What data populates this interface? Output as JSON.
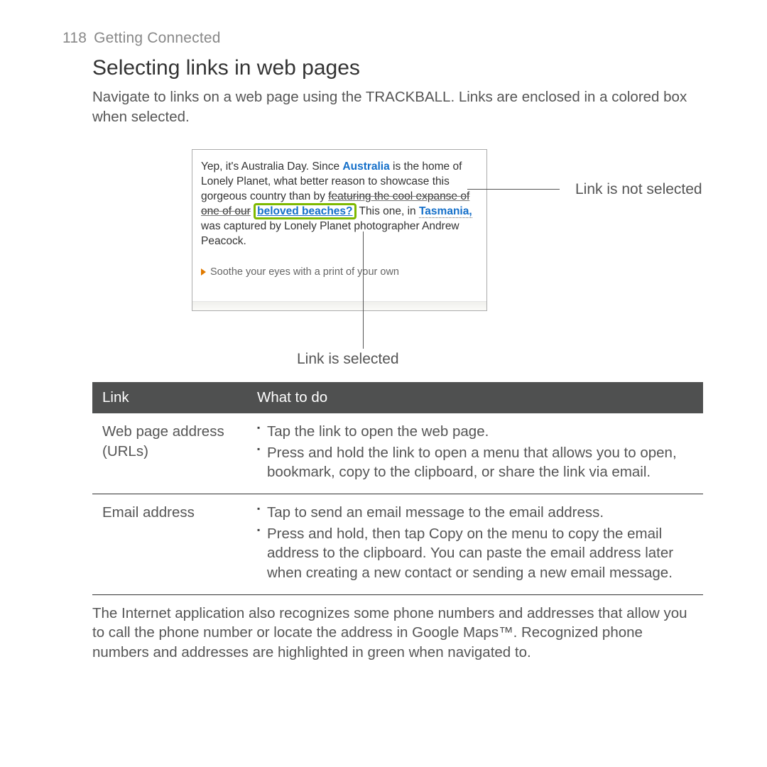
{
  "page": {
    "number": "118",
    "chapter": "Getting Connected"
  },
  "section": {
    "title": "Selecting links in web pages",
    "intro": "Navigate to links on a web page using the TRACKBALL. Links are enclosed in a colored box when selected."
  },
  "figure": {
    "text_prefix": "Yep, it's Australia Day. Since ",
    "link_australia": "Australia",
    "text_mid1": " is the home of Lonely Planet, what better reason to showcase this gorgeous country than by ",
    "text_strike": "featuring the cool expanse of one of our",
    "link_selected": "beloved beaches?",
    "text_mid2": " This one, in ",
    "link_tasmania": "Tasmania,",
    "text_suffix": " was captured by Lonely Planet photographer Andrew Peacock.",
    "footer_line": "Soothe your eyes with a print of your own",
    "callout_not_selected": "Link is not selected",
    "callout_selected": "Link is selected"
  },
  "table": {
    "headers": [
      "Link",
      "What to do"
    ],
    "rows": [
      {
        "cell1": "Web page address (URLs)",
        "items": [
          "Tap the link to open the web page.",
          "Press and hold the link to open a menu that allows you to open, bookmark, copy to the clipboard, or share the link via email."
        ]
      },
      {
        "cell1": "Email address",
        "items": [
          "Tap to send an email message to the email address.",
          "Press and hold, then tap Copy on the menu to copy the email address to the clipboard. You can paste the email address later when creating a new contact or sending a new email message."
        ]
      }
    ]
  },
  "after_text": "The Internet application also recognizes some phone numbers and addresses that allow you to call the phone number or locate the address in Google Maps™. Recognized phone numbers and addresses are highlighted in green when navigated to."
}
